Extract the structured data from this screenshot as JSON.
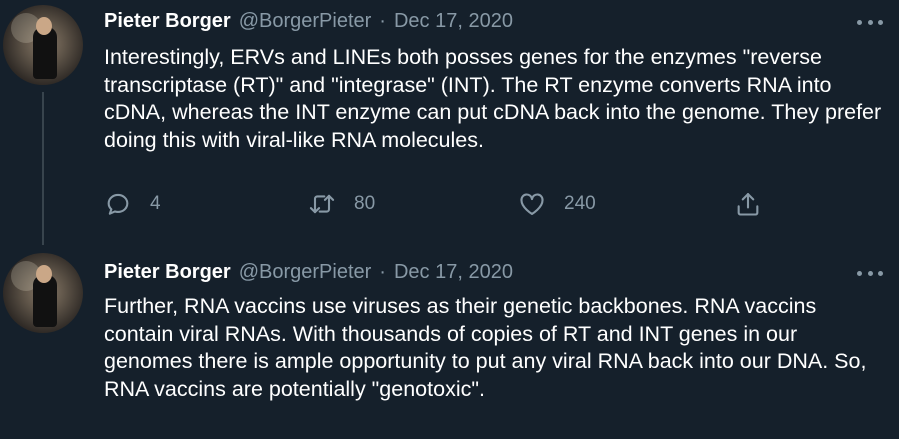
{
  "tweets": [
    {
      "author_name": "Pieter Borger",
      "handle": "@BorgerPieter",
      "separator": "·",
      "date": "Dec 17, 2020",
      "text": "Interestingly, ERVs and LINEs both posses genes for the enzymes \"reverse transcriptase (RT)\" and \"integrase\" (INT). The RT enzyme converts RNA into cDNA, whereas the INT enzyme can put cDNA back into the genome. They prefer doing this with viral-like RNA molecules.",
      "reply_count": "4",
      "retweet_count": "80",
      "like_count": "240",
      "icons": {
        "reply": "reply-icon",
        "retweet": "retweet-icon",
        "like": "heart-icon",
        "share": "share-icon",
        "more": "more-icon"
      }
    },
    {
      "author_name": "Pieter Borger",
      "handle": "@BorgerPieter",
      "separator": "·",
      "date": "Dec 17, 2020",
      "text": "Further, RNA vaccins use viruses as their genetic backbones. RNA vaccins contain viral RNAs. With thousands of copies of RT and INT genes in our genomes there is ample opportunity to put any viral RNA back into our DNA. So, RNA vaccins are potentially \"genotoxic\".",
      "icons": {
        "more": "more-icon"
      }
    }
  ],
  "colors": {
    "background": "#15202b",
    "primary_text": "#ffffff",
    "secondary_text": "#8899a6",
    "thread_line": "#38444d"
  }
}
